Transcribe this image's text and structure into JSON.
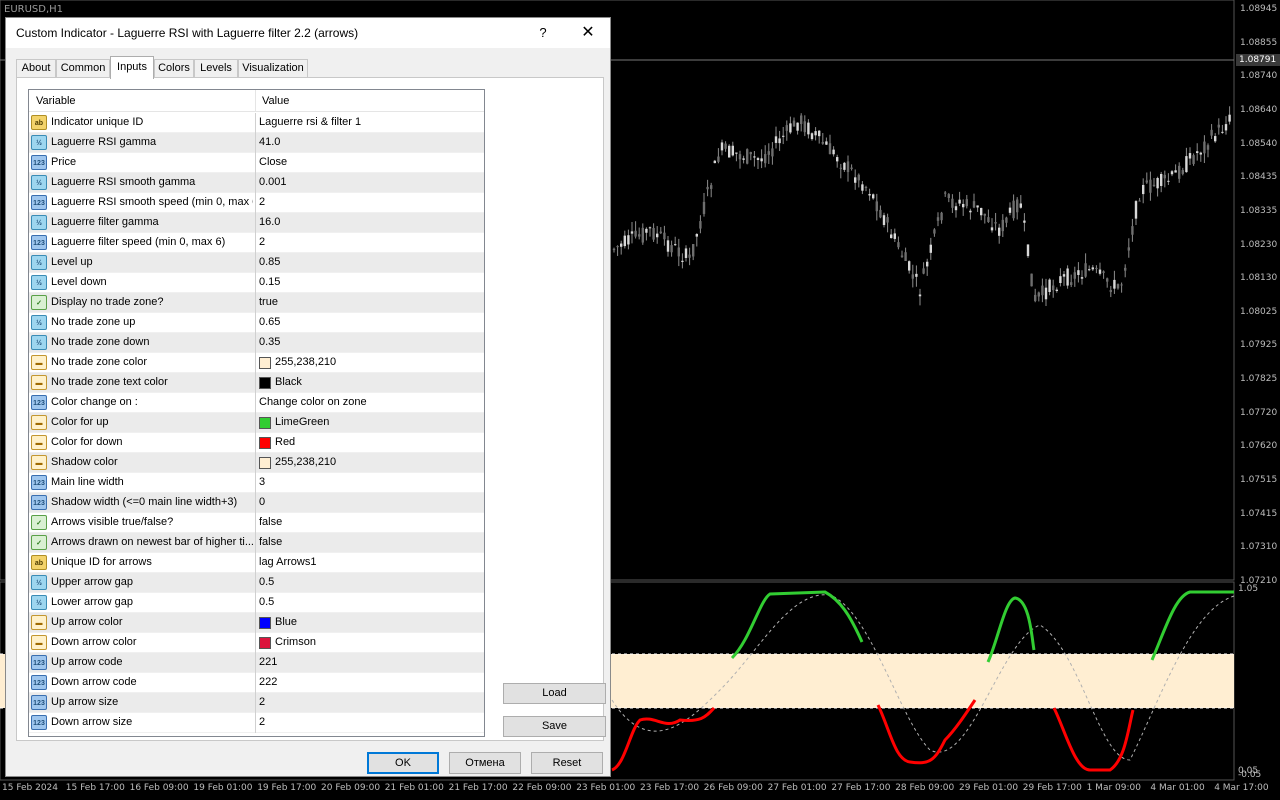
{
  "chart": {
    "symbol": "EURUSD,H1",
    "current_price": "1.08791",
    "price_ticks": [
      "1.08945",
      "1.08855",
      "1.08740",
      "1.08640",
      "1.08540",
      "1.08435",
      "1.08335",
      "1.08230",
      "1.08130",
      "1.08025",
      "1.07925",
      "1.07825",
      "1.07720",
      "1.07620",
      "1.07515",
      "1.07415",
      "1.07310",
      "1.07210"
    ],
    "osc_ticks": [
      "1.05",
      "0.05",
      "-0.05"
    ],
    "time_ticks": [
      "15 Feb 2024",
      "15 Feb 17:00",
      "16 Feb 09:00",
      "19 Feb 01:00",
      "19 Feb 17:00",
      "20 Feb 09:00",
      "21 Feb 01:00",
      "21 Feb 17:00",
      "22 Feb 09:00",
      "23 Feb 01:00",
      "23 Feb 17:00",
      "26 Feb 09:00",
      "27 Feb 01:00",
      "27 Feb 17:00",
      "28 Feb 09:00",
      "29 Feb 01:00",
      "29 Feb 17:00",
      "1 Mar 09:00",
      "4 Mar 01:00",
      "4 Mar 17:00"
    ],
    "colors": {
      "up": "#32cd32",
      "down": "#ff0000",
      "zone": "#ffeed2",
      "signal": "#b0b0b0"
    }
  },
  "dialog": {
    "title": "Custom Indicator - Laguerre RSI with Laguerre filter 2.2 (arrows)",
    "help": "?",
    "close": "✕",
    "tabs": [
      "About",
      "Common",
      "Inputs",
      "Colors",
      "Levels",
      "Visualization"
    ],
    "active_tab": "Inputs",
    "columns": {
      "variable": "Variable",
      "value": "Value"
    },
    "rows": [
      {
        "icon": "ab",
        "name": "Indicator unique ID",
        "value": "Laguerre rsi & filter 1"
      },
      {
        "icon": "dbl",
        "name": "Laguerre RSI gamma",
        "value": "41.0"
      },
      {
        "icon": "int",
        "name": "Price",
        "value": "Close"
      },
      {
        "icon": "dbl",
        "name": "Laguerre RSI smooth gamma",
        "value": "0.001"
      },
      {
        "icon": "int",
        "name": "Laguerre RSI smooth speed (min 0, max 6)",
        "value": "2"
      },
      {
        "icon": "dbl",
        "name": "Laguerre filter gamma",
        "value": "16.0"
      },
      {
        "icon": "int",
        "name": "Laguerre filter speed (min 0, max 6)",
        "value": "2"
      },
      {
        "icon": "dbl",
        "name": "Level up",
        "value": "0.85"
      },
      {
        "icon": "dbl",
        "name": "Level down",
        "value": "0.15"
      },
      {
        "icon": "bool",
        "name": "Display no trade zone?",
        "value": "true"
      },
      {
        "icon": "dbl",
        "name": "No trade zone up",
        "value": "0.65"
      },
      {
        "icon": "dbl",
        "name": "No trade zone down",
        "value": "0.35"
      },
      {
        "icon": "col",
        "name": "No trade zone color",
        "value": "255,238,210",
        "swatch": "#ffeed2"
      },
      {
        "icon": "col",
        "name": "No trade zone text color",
        "value": "Black",
        "swatch": "#000000"
      },
      {
        "icon": "int",
        "name": "Color change on :",
        "value": "Change color on zone"
      },
      {
        "icon": "col",
        "name": "Color for up",
        "value": "LimeGreen",
        "swatch": "#32cd32"
      },
      {
        "icon": "col",
        "name": "Color for down",
        "value": "Red",
        "swatch": "#ff0000"
      },
      {
        "icon": "col",
        "name": "Shadow color",
        "value": "255,238,210",
        "swatch": "#ffeed2"
      },
      {
        "icon": "int",
        "name": "Main line width",
        "value": "3"
      },
      {
        "icon": "int",
        "name": "Shadow width (<=0 main line width+3)",
        "value": "0"
      },
      {
        "icon": "bool",
        "name": "Arrows visible true/false?",
        "value": "false"
      },
      {
        "icon": "bool",
        "name": "Arrows drawn on newest bar of higher ti...",
        "value": "false"
      },
      {
        "icon": "ab",
        "name": "Unique ID for arrows",
        "value": "lag Arrows1"
      },
      {
        "icon": "dbl",
        "name": "Upper arrow gap",
        "value": "0.5"
      },
      {
        "icon": "dbl",
        "name": "Lower arrow gap",
        "value": "0.5"
      },
      {
        "icon": "col",
        "name": "Up arrow color",
        "value": "Blue",
        "swatch": "#0000ff"
      },
      {
        "icon": "col",
        "name": "Down arrow color",
        "value": "Crimson",
        "swatch": "#dc143c"
      },
      {
        "icon": "int",
        "name": "Up arrow code",
        "value": "221"
      },
      {
        "icon": "int",
        "name": "Down arrow code",
        "value": "222"
      },
      {
        "icon": "int",
        "name": "Up arrow size",
        "value": "2"
      },
      {
        "icon": "int",
        "name": "Down arrow size",
        "value": "2"
      }
    ],
    "buttons": {
      "load": "Load",
      "save": "Save",
      "ok": "OK",
      "cancel": "Отмена",
      "reset": "Reset"
    }
  }
}
